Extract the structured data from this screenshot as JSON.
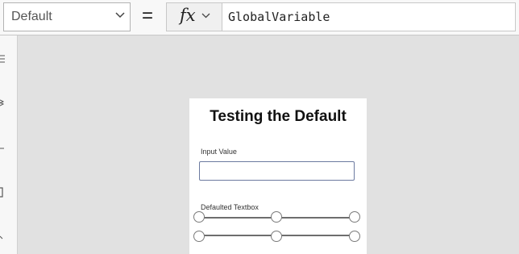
{
  "toolbar": {
    "property_dropdown": {
      "selected": "Default"
    },
    "equals_sign": "=",
    "fx_label": "fx",
    "formula": "GlobalVariable"
  },
  "left_rail": {
    "icons": [
      "hamburger-menu-icon",
      "layers-icon",
      "minus-icon",
      "screen-icon",
      "more-icon"
    ]
  },
  "screen": {
    "title": "Testing the Default",
    "input_label": "Input Value",
    "input_value": "",
    "defaulted_label": "Defaulted Textbox"
  },
  "colors": {
    "canvas_background": "#e1e1e1",
    "toolbar_background": "#f8f8f8",
    "screen_background": "#ffffff",
    "input_border": "#6c7aa0"
  }
}
